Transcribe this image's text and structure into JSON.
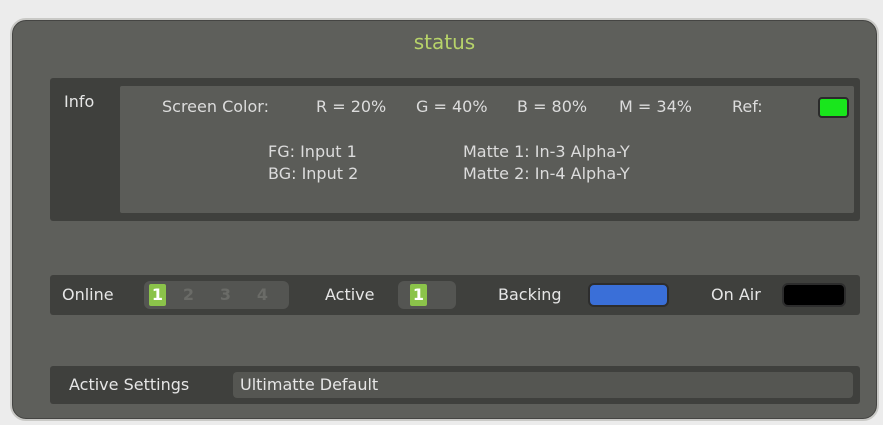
{
  "title": "status",
  "info": {
    "label": "Info",
    "screen_color_label": "Screen Color:",
    "r": "R = 20%",
    "g": "G = 40%",
    "b": "B = 80%",
    "m": "M = 34%",
    "ref_label": "Ref:",
    "ref_color": "#19e61c",
    "fg": "FG: Input 1",
    "bg": "BG: Input 2",
    "matte1": "Matte 1: In-3 Alpha-Y",
    "matte2": "Matte 2: In-4 Alpha-Y"
  },
  "status_bar": {
    "online_label": "Online",
    "online_inputs": [
      "1",
      "2",
      "3",
      "4"
    ],
    "active_label": "Active",
    "active_input": "1",
    "backing_label": "Backing",
    "backing_color": "#3a6fd8",
    "on_air_label": "On Air",
    "on_air_color": "#000000",
    "chip_color": "#8bc34a"
  },
  "settings": {
    "label": "Active Settings",
    "value": "Ultimatte Default"
  }
}
